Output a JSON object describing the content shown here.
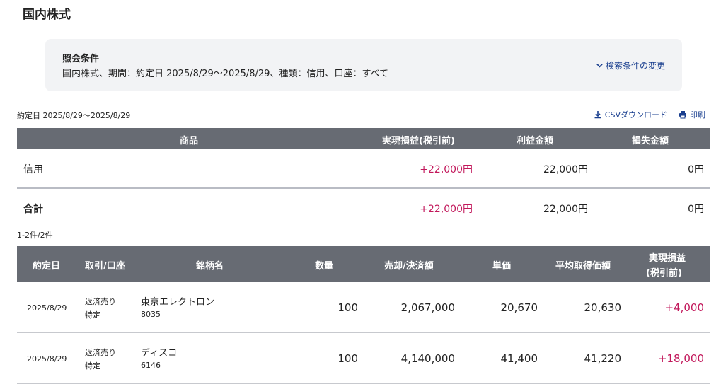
{
  "page": {
    "title": "国内株式"
  },
  "conditions": {
    "title": "照会条件",
    "text": "国内株式、期間：約定日 2025/8/29〜2025/8/29、種類：信用、口座：すべて",
    "change_label": "検索条件の変更"
  },
  "period_label": "約定日 2025/8/29〜2025/8/29",
  "links": {
    "csv": "CSVダウンロード",
    "print": "印刷"
  },
  "summary": {
    "headers": [
      "商品",
      "実現損益(税引前)",
      "利益金額",
      "損失金額"
    ],
    "rows": [
      {
        "product": "信用",
        "realized": "+22,000円",
        "profit": "22,000円",
        "loss": "0円"
      }
    ],
    "total": {
      "label": "合計",
      "realized": "+22,000円",
      "profit": "22,000円",
      "loss": "0円"
    }
  },
  "count_label": "1-2件/2件",
  "detail": {
    "headers": [
      "約定日",
      "取引/口座",
      "銘柄名",
      "数量",
      "売却/決済額",
      "単価",
      "平均取得価額",
      "実現損益",
      "(税引前)"
    ],
    "rows": [
      {
        "date": "2025/8/29",
        "trade": "返済売り",
        "account": "特定",
        "name": "東京エレクトロン",
        "code": "8035",
        "qty": "100",
        "amount": "2,067,000",
        "price": "20,670",
        "avg": "20,630",
        "pl": "+4,000"
      },
      {
        "date": "2025/8/29",
        "trade": "返済売り",
        "account": "特定",
        "name": "ディスコ",
        "code": "6146",
        "qty": "100",
        "amount": "4,140,000",
        "price": "41,400",
        "avg": "41,220",
        "pl": "+18,000"
      }
    ]
  },
  "colors": {
    "header_bg": "#676b73",
    "positive": "#c2185b",
    "link": "#1a3f8f",
    "panel_bg": "#f2f3f5"
  }
}
